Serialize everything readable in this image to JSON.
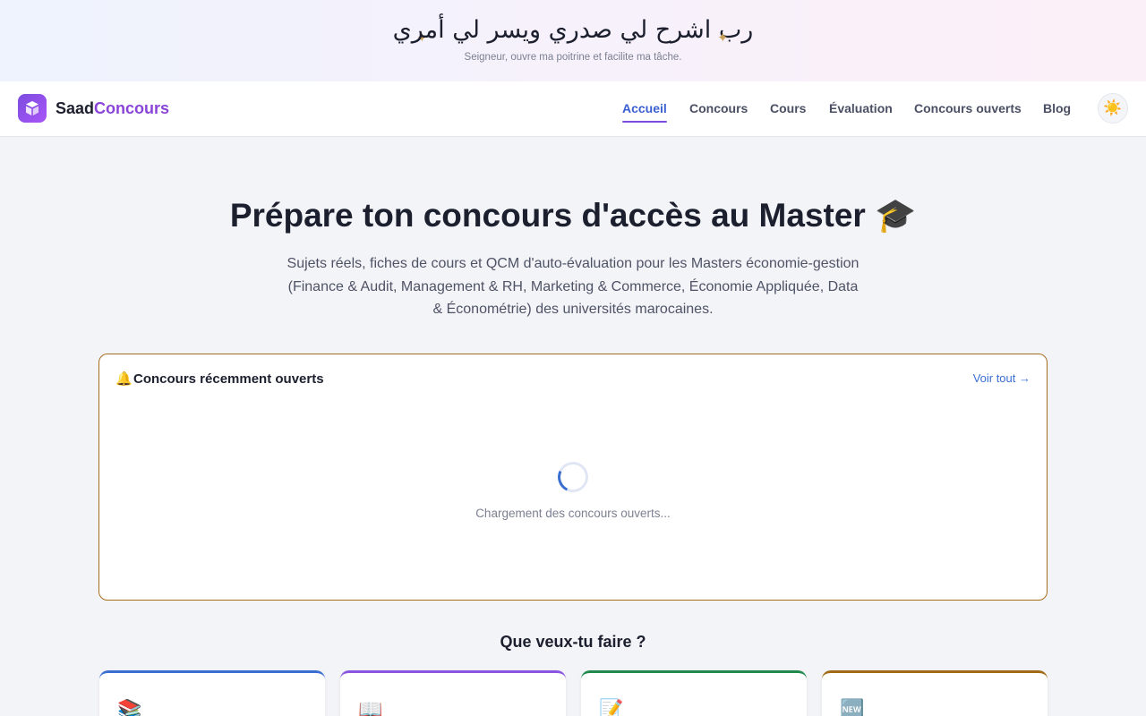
{
  "banner": {
    "arabic": "رب اشرح لي صدري ويسر لي أمري",
    "star": "✦",
    "translation": "Seigneur, ouvre ma poitrine et facilite ma tâche."
  },
  "header": {
    "brand_a": "Saad",
    "brand_b": "Concours",
    "nav": [
      {
        "label": "Accueil"
      },
      {
        "label": "Concours"
      },
      {
        "label": "Cours"
      },
      {
        "label": "Évaluation"
      },
      {
        "label": "Concours ouverts"
      },
      {
        "label": "Blog"
      }
    ],
    "theme_icon": "☀️"
  },
  "hero": {
    "title": "Prépare ton concours d'accès au Master 🎓",
    "subtitle": "Sujets réels, fiches de cours et QCM d'auto-évaluation pour les Masters économie-gestion (Finance & Audit, Management & RH, Marketing & Commerce, Économie Appliquée, Data & Économétrie) des universités marocaines."
  },
  "recent": {
    "icon": "🔔",
    "title": "Concours récemment ouverts",
    "see_all": "Voir tout →",
    "loading": "Chargement des concours ouverts..."
  },
  "actions": {
    "title": "Que veux-tu faire ?",
    "cards": [
      {
        "icon": "📚",
        "color": "#3a6fd1"
      },
      {
        "icon": "📖",
        "color": "#8a55e0"
      },
      {
        "icon": "📝",
        "color": "#1f8a4c"
      },
      {
        "icon": "🆕",
        "color": "#a26a14"
      }
    ]
  },
  "colors": {
    "accent": "#7c4ce0",
    "link": "#3a6fd1",
    "card_border": "#a46d22"
  }
}
